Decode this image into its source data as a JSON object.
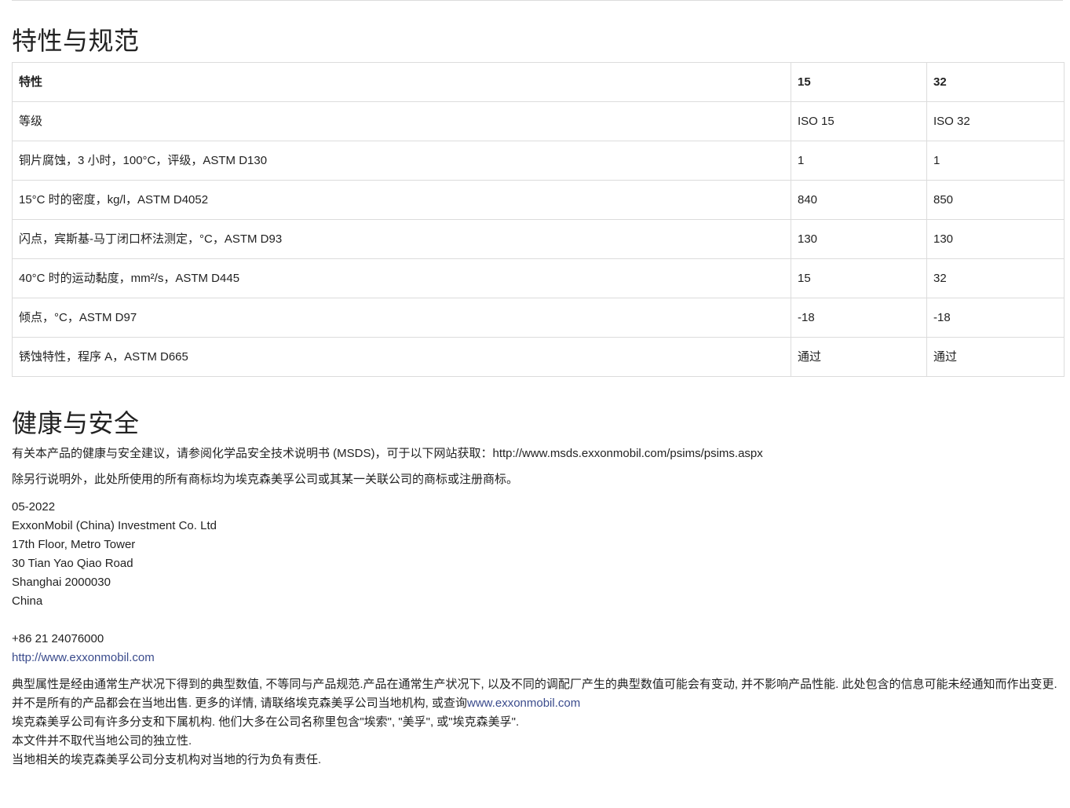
{
  "properties": {
    "title": "特性与规范",
    "headers": [
      "特性",
      "15",
      "32"
    ],
    "rows": [
      [
        "等级",
        "ISO 15",
        "ISO 32"
      ],
      [
        "铜片腐蚀，3 小时，100°C，评级，ASTM D130",
        "1",
        "1"
      ],
      [
        "15°C 时的密度，kg/l，ASTM D4052",
        "840",
        "850"
      ],
      [
        "闪点，宾斯基-马丁闭口杯法测定，°C，ASTM D93",
        "130",
        "130"
      ],
      [
        "40°C 时的运动黏度，mm²/s，ASTM D445",
        "15",
        "32"
      ],
      [
        "倾点，°C，ASTM D97",
        "-18",
        "-18"
      ],
      [
        "锈蚀特性，程序 A，ASTM D665",
        "通过",
        "通过"
      ]
    ]
  },
  "health": {
    "title": "健康与安全",
    "msds_text": "有关本产品的健康与安全建议，请参阅化学品安全技术说明书 (MSDS)，可于以下网站获取：http://www.msds.exxonmobil.com/psims/psims.aspx",
    "trademark_text": "除另行说明外，此处所使用的所有商标均为埃克森美孚公司或其某一关联公司的商标或注册商标。"
  },
  "address": {
    "date": "05-2022",
    "company": "ExxonMobil (China) Investment Co. Ltd",
    "line1": "17th Floor, Metro Tower",
    "line2": "30 Tian Yao Qiao Road",
    "line3": "Shanghai 2000030",
    "country": "China",
    "phone": "+86 21 24076000",
    "website": "http://www.exxonmobil.com"
  },
  "disclaimer": {
    "line1": "典型属性是经由通常生产状况下得到的典型数值, 不等同与产品规范.产品在通常生产状况下, 以及不同的调配厂产生的典型数值可能会有变动, 并不影响产品性能. 此处包含的信息可能未经通知而作出变更. 并不是所有的产品都会在当地出售. 更多的详情, 请联络埃克森美孚公司当地机构, 或查询",
    "link": "www.exxonmobil.com",
    "line2": "埃克森美孚公司有许多分支和下属机构. 他们大多在公司名称里包含\"埃索\", \"美孚\", 或\"埃克森美孚\".",
    "line3": "本文件并不取代当地公司的独立性.",
    "line4": "当地相关的埃克森美孚公司分支机构对当地的行为负有责任."
  }
}
